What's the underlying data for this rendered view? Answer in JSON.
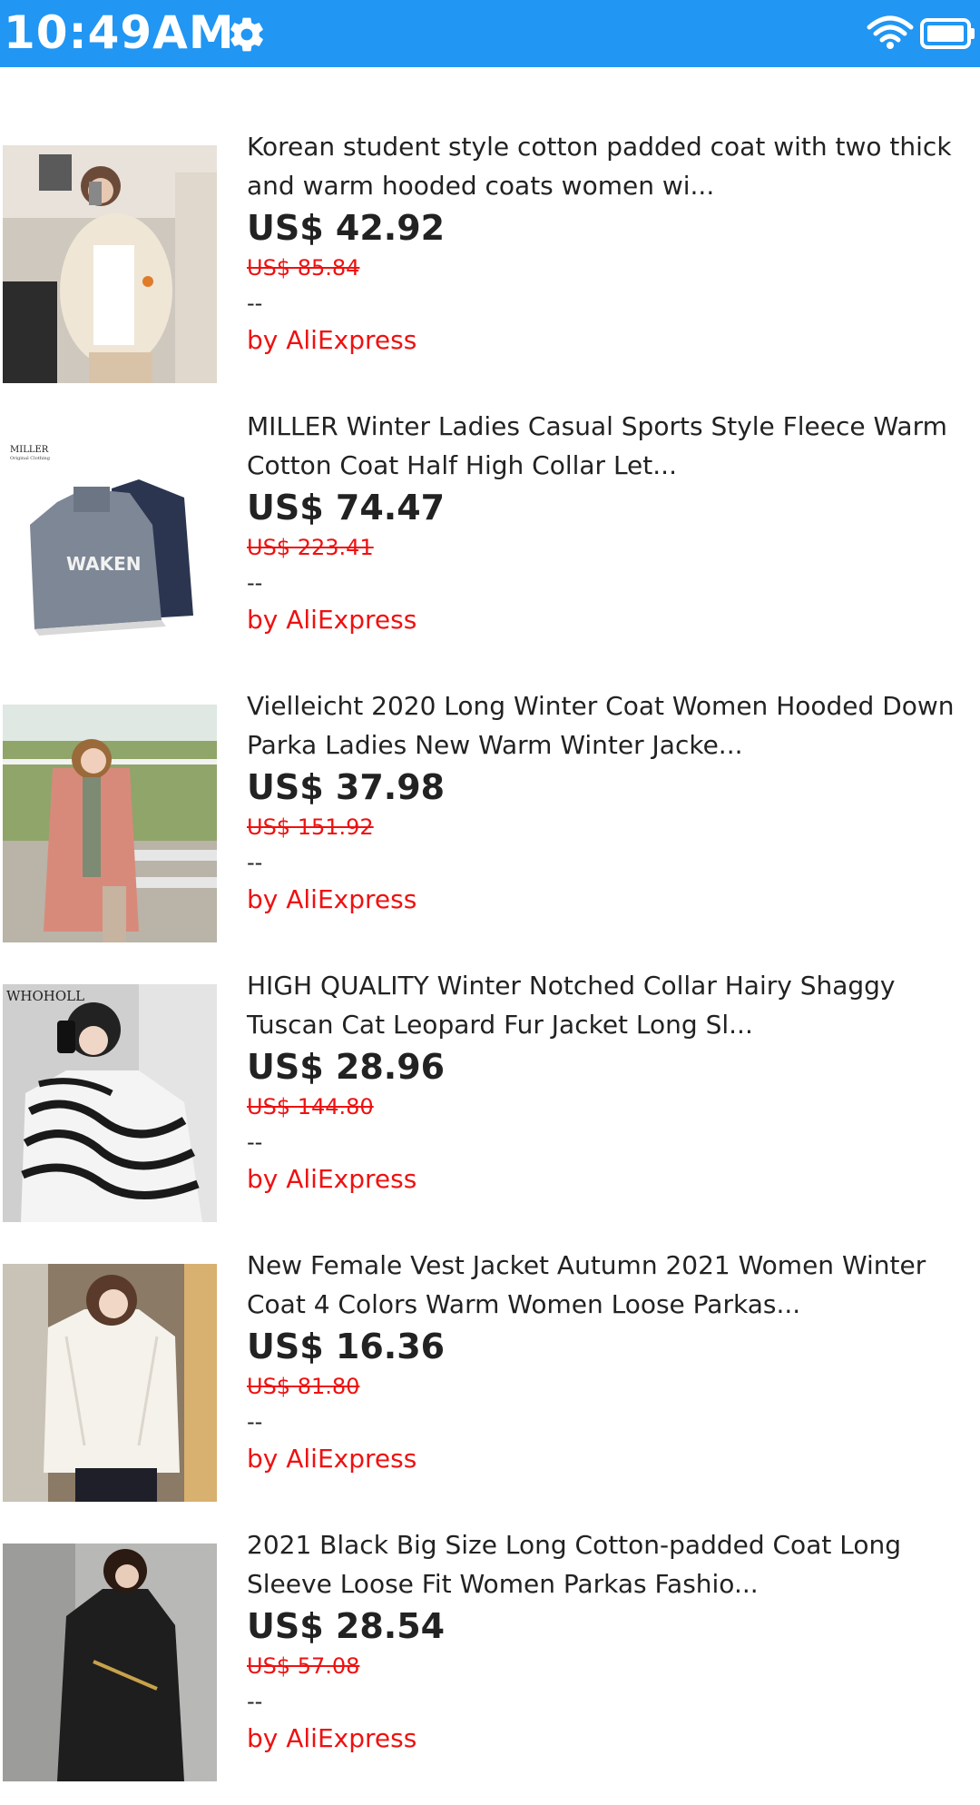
{
  "status_bar": {
    "time": "10:49AM",
    "background": "#2196F3",
    "icons": [
      "gear-icon",
      "wifi-icon",
      "battery-icon"
    ]
  },
  "products": [
    {
      "title": "Korean student style cotton padded coat with two thick and warm hooded coats women wi...",
      "price": "US$ 42.92",
      "original_price": "US$ 85.84",
      "rating": "--",
      "seller": "by AliExpress"
    },
    {
      "title": "MILLER Winter Ladies Casual Sports Style Fleece Warm Cotton Coat Half High Collar Let...",
      "price": "US$ 74.47",
      "original_price": "US$ 223.41",
      "rating": "--",
      "seller": "by AliExpress"
    },
    {
      "title": "Vielleicht 2020 Long Winter Coat Women Hooded Down Parka Ladies New Warm Winter Jacke...",
      "price": "US$ 37.98",
      "original_price": "US$ 151.92",
      "rating": "--",
      "seller": "by AliExpress"
    },
    {
      "title": "HIGH QUALITY Winter Notched Collar Hairy Shaggy Tuscan Cat Leopard Fur Jacket Long Sl...",
      "price": "US$ 28.96",
      "original_price": "US$ 144.80",
      "rating": "--",
      "seller": "by AliExpress"
    },
    {
      "title": "New Female Vest Jacket Autumn 2021 Women Winter Coat 4 Colors Warm Women Loose Parkas...",
      "price": "US$ 16.36",
      "original_price": "US$ 81.80",
      "rating": "--",
      "seller": "by AliExpress"
    },
    {
      "title": "2021 Black Big Size Long Cotton-padded Coat Long Sleeve Loose Fit Women Parkas Fashio...",
      "price": "US$ 28.54",
      "original_price": "US$ 57.08",
      "rating": "--",
      "seller": "by AliExpress"
    }
  ],
  "thumbnail_texts": {
    "miller_brand": "MILLER",
    "miller_sub": "Original Clothing",
    "waken": "WAKEN",
    "whoholl": "WHOHOLL"
  },
  "colors": {
    "price_text": "#222222",
    "strike_price": "#ee1111",
    "seller": "#ee1111"
  }
}
